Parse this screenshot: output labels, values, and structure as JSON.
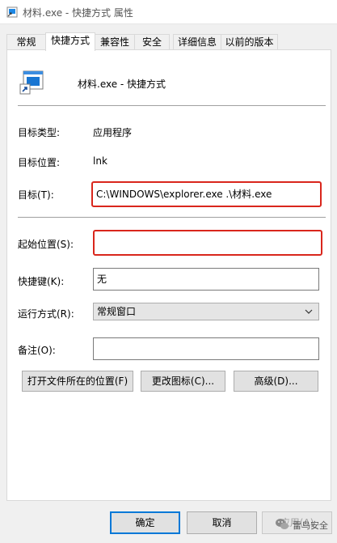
{
  "window": {
    "title": "材料.exe - 快捷方式 属性"
  },
  "tabs": [
    {
      "label": "常规"
    },
    {
      "label": "快捷方式",
      "active": true
    },
    {
      "label": "兼容性"
    },
    {
      "label": "安全"
    },
    {
      "label": "详细信息"
    },
    {
      "label": "以前的版本"
    }
  ],
  "shortcut": {
    "name": "材料.exe - 快捷方式",
    "target_type_label": "目标类型:",
    "target_type_value": "应用程序",
    "target_location_label": "目标位置:",
    "target_location_value": "lnk",
    "target_label": "目标(T):",
    "target_value": "C:\\WINDOWS\\explorer.exe .\\材料.exe",
    "start_in_label": "起始位置(S):",
    "start_in_value": "",
    "hotkey_label": "快捷键(K):",
    "hotkey_value": "无",
    "run_label": "运行方式(R):",
    "run_value": "常规窗口",
    "comment_label": "备注(O):",
    "comment_value": ""
  },
  "actions": {
    "open_location": "打开文件所在的位置(F)",
    "change_icon": "更改图标(C)...",
    "advanced": "高级(D)..."
  },
  "footer": {
    "ok": "确定",
    "cancel": "取消",
    "apply": "应用(A)"
  },
  "watermark": {
    "text": "雷鸟安全"
  },
  "colors": {
    "highlight_border": "#d9261c",
    "accent": "#0078d7"
  }
}
